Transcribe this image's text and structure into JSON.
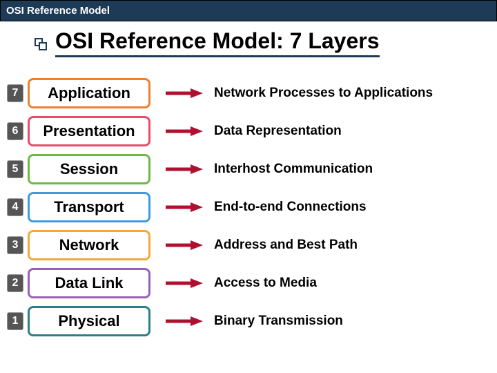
{
  "header": {
    "title": "OSI Reference Model"
  },
  "page_title": "OSI Reference Model: 7 Layers",
  "layers": [
    {
      "num": "7",
      "name": "Application",
      "desc": "Network Processes to Applications"
    },
    {
      "num": "6",
      "name": "Presentation",
      "desc": "Data Representation"
    },
    {
      "num": "5",
      "name": "Session",
      "desc": "Interhost Communication"
    },
    {
      "num": "4",
      "name": "Transport",
      "desc": "End-to-end Connections"
    },
    {
      "num": "3",
      "name": "Network",
      "desc": "Address and Best Path"
    },
    {
      "num": "2",
      "name": "Data Link",
      "desc": "Access to Media"
    },
    {
      "num": "1",
      "name": "Physical",
      "desc": "Binary Transmission"
    }
  ]
}
